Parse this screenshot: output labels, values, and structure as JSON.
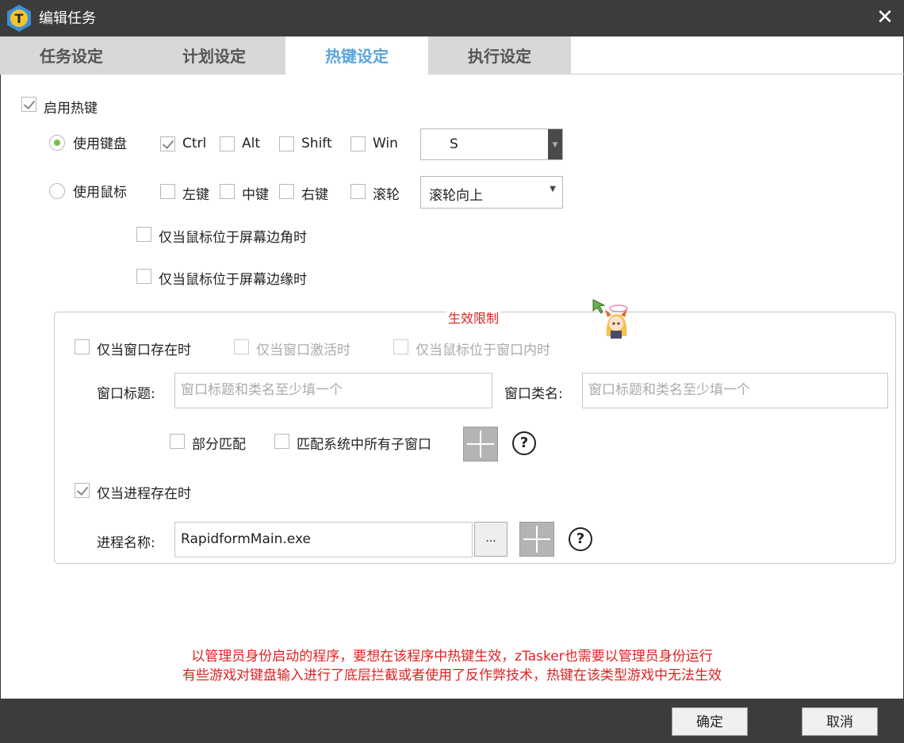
{
  "window": {
    "title": "编辑任务",
    "close": "✕"
  },
  "tabs": [
    {
      "label": "任务设定"
    },
    {
      "label": "计划设定"
    },
    {
      "label": "热键设定",
      "active": true
    },
    {
      "label": "执行设定"
    }
  ],
  "hotkey": {
    "enable_label": "启用热键",
    "enable_checked": true,
    "keyboard": {
      "label": "使用键盘",
      "selected": true,
      "modifiers": [
        {
          "label": "Ctrl",
          "checked": true
        },
        {
          "label": "Alt",
          "checked": false
        },
        {
          "label": "Shift",
          "checked": false
        },
        {
          "label": "Win",
          "checked": false
        }
      ],
      "key_value": "S"
    },
    "mouse": {
      "label": "使用鼠标",
      "selected": false,
      "buttons": [
        {
          "label": "左键",
          "checked": false
        },
        {
          "label": "中键",
          "checked": false
        },
        {
          "label": "右键",
          "checked": false
        },
        {
          "label": "滚轮",
          "checked": false
        }
      ],
      "wheel_value": "滚轮向上",
      "corner_label": "仅当鼠标位于屏幕边角时",
      "edge_label": "仅当鼠标位于屏幕边缘时"
    }
  },
  "restriction": {
    "title": "生效限制",
    "window_exists_label": "仅当窗口存在时",
    "window_active_label": "仅当窗口激活时",
    "mouse_in_window_label": "仅当鼠标位于窗口内时",
    "window_title_label": "窗口标题:",
    "window_title_placeholder": "窗口标题和类名至少填一个",
    "window_class_label": "窗口类名:",
    "window_class_placeholder": "窗口标题和类名至少填一个",
    "partial_match_label": "部分匹配",
    "match_children_label": "匹配系统中所有子窗口",
    "help": "?",
    "process_exists_label": "仅当进程存在时",
    "process_exists_checked": true,
    "process_name_label": "进程名称:",
    "process_name_value": "RapidformMain.exe",
    "browse_label": "..."
  },
  "notes": {
    "line1": "以管理员身份启动的程序，要想在该程序中热键生效，zTasker也需要以管理员身份运行",
    "line2": "有些游戏对键盘输入进行了底层拦截或者使用了反作弊技术，热键在该类型游戏中无法生效"
  },
  "footer": {
    "ok": "确定",
    "cancel": "取消"
  },
  "colors": {
    "titlebar": "#3c3c3c",
    "accent_tab": "#5aa5de",
    "warning": "#e02020",
    "radio_selected": "#7ac143"
  }
}
